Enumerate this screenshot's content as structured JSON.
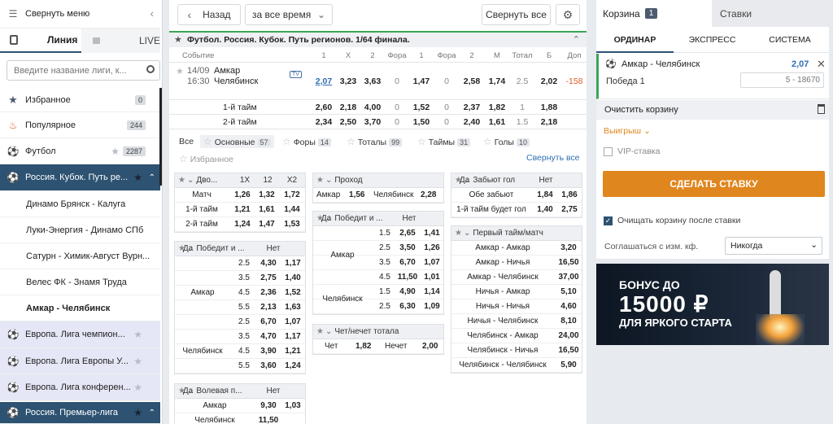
{
  "left": {
    "collapse": "Свернуть меню",
    "tab_line": "Линия",
    "tab_live": "LIVE",
    "search_placeholder": "Введите название лиги, к...",
    "items": [
      {
        "label": "Избранное",
        "badge": "0"
      },
      {
        "label": "Популярное",
        "badge": "244"
      },
      {
        "label": "Футбол",
        "badge": "2287"
      },
      {
        "label": "Россия. Кубок. Путь ре..."
      },
      {
        "label": "Динамо Брянск - Калуга"
      },
      {
        "label": "Луки-Энергия - Динамо СПб"
      },
      {
        "label": "Сатурн - Химик-Август Вурн..."
      },
      {
        "label": "Велес ФК - Знамя Труда"
      },
      {
        "label": "Амкар - Челябинск"
      },
      {
        "label": "Европа. Лига чемпион..."
      },
      {
        "label": "Европа. Лига Европы У..."
      },
      {
        "label": "Европа. Лига конферен..."
      },
      {
        "label": "Россия. Премьер-лига"
      }
    ]
  },
  "top": {
    "back": "Назад",
    "period": "за все время",
    "collapse_all": "Свернуть все"
  },
  "league": "Футбол. Россия. Кубок. Путь регионов. 1/64 финала.",
  "headers": [
    "Событие",
    "1",
    "X",
    "2",
    "Фора",
    "1",
    "Фора",
    "2",
    "М",
    "Тотал",
    "Б",
    "Доп"
  ],
  "event": {
    "date": "14/09",
    "time": "16:30",
    "team1": "Амкар",
    "team2": "Челябинск",
    "tv": "TV",
    "odds": [
      "2,07",
      "3,23",
      "3,63",
      "0",
      "1,47",
      "0",
      "2,58",
      "1,74",
      "2.5",
      "2,02",
      "-158"
    ]
  },
  "halves": [
    {
      "label": "1-й тайм",
      "odds": [
        "2,60",
        "2,18",
        "4,00",
        "0",
        "1,52",
        "0",
        "2,37",
        "1,82",
        "1",
        "1,88"
      ]
    },
    {
      "label": "2-й тайм",
      "odds": [
        "2,34",
        "2,50",
        "3,70",
        "0",
        "1,50",
        "0",
        "2,40",
        "1,61",
        "1.5",
        "2,18"
      ]
    }
  ],
  "tabs": [
    {
      "label": "Все"
    },
    {
      "label": "Основные",
      "count": "57"
    },
    {
      "label": "Форы",
      "count": "14"
    },
    {
      "label": "Тоталы",
      "count": "99"
    },
    {
      "label": "Таймы",
      "count": "31"
    },
    {
      "label": "Голы",
      "count": "10"
    }
  ],
  "fav": "Избранное",
  "collapse_all2": "Свернуть все",
  "m1": {
    "h": [
      "Дво...",
      "1X",
      "12",
      "X2"
    ],
    "rows": [
      [
        "Матч",
        "1,26",
        "1,32",
        "1,72"
      ],
      [
        "1-й тайм",
        "1,21",
        "1,61",
        "1,44"
      ],
      [
        "2-й тайм",
        "1,24",
        "1,47",
        "1,53"
      ]
    ]
  },
  "m2": {
    "h": [
      "Победит и ...",
      "Да",
      "Нет"
    ],
    "t1": "Амкар",
    "t2": "Челябинск",
    "rows": [
      [
        "2.5",
        "4,30",
        "1,17"
      ],
      [
        "3.5",
        "2,75",
        "1,40"
      ],
      [
        "4.5",
        "2,36",
        "1,52"
      ],
      [
        "5.5",
        "2,13",
        "1,63"
      ],
      [
        "2.5",
        "6,70",
        "1,07"
      ],
      [
        "3.5",
        "4,70",
        "1,17"
      ],
      [
        "4.5",
        "3,90",
        "1,21"
      ],
      [
        "5.5",
        "3,60",
        "1,24"
      ]
    ]
  },
  "m3": {
    "h": [
      "Волевая п...",
      "Да",
      "Нет"
    ],
    "rows": [
      [
        "Амкар",
        "9,30",
        "1,03"
      ],
      [
        "Челябинск",
        "11,50",
        ""
      ]
    ]
  },
  "m4": {
    "h": "Проход",
    "row": [
      "Амкар",
      "1,56",
      "Челябинск",
      "2,28"
    ]
  },
  "m5": {
    "h": [
      "Победит и ...",
      "Да",
      "Нет"
    ],
    "t1": "Амкар",
    "t2": "Челябинск",
    "rows": [
      [
        "1.5",
        "2,65",
        "1,41"
      ],
      [
        "2.5",
        "3,50",
        "1,26"
      ],
      [
        "3.5",
        "6,70",
        "1,07"
      ],
      [
        "4.5",
        "11,50",
        "1,01"
      ],
      [
        "1.5",
        "4,90",
        "1,14"
      ],
      [
        "2.5",
        "6,30",
        "1,09"
      ]
    ]
  },
  "m6": {
    "h": "Чет/нечет тотала",
    "row": [
      "Чет",
      "1,82",
      "Нечет",
      "2,00"
    ]
  },
  "m7": {
    "h": [
      "Забьют гол",
      "Да",
      "Нет"
    ],
    "rows": [
      [
        "Обе забьют",
        "1,84",
        "1,86"
      ],
      [
        "1-й тайм будет гол",
        "1,40",
        "2,75"
      ]
    ]
  },
  "m8": {
    "h": "Первый тайм/матч",
    "rows": [
      [
        "Амкар - Амкар",
        "3,20"
      ],
      [
        "Амкар - Ничья",
        "16,50"
      ],
      [
        "Амкар - Челябинск",
        "37,00"
      ],
      [
        "Ничья - Амкар",
        "5,10"
      ],
      [
        "Ничья - Ничья",
        "4,60"
      ],
      [
        "Ничья - Челябинск",
        "8,10"
      ],
      [
        "Челябинск - Амкар",
        "24,00"
      ],
      [
        "Челябинск - Ничья",
        "16,50"
      ],
      [
        "Челябинск - Челябинск",
        "5,90"
      ]
    ]
  },
  "cart": {
    "title": "Корзина",
    "count": "1",
    "bets": "Ставки",
    "types": [
      "ОРДИНАР",
      "ЭКСПРЕСС",
      "СИСТЕМА"
    ],
    "match": "Амкар - Челябинск",
    "odd": "2,07",
    "outcome": "Победа 1",
    "placeholder": "5 - 18670",
    "clear": "Очистить корзину",
    "win": "Выигрыш",
    "vip": "VIP-ставка",
    "make": "СДЕЛАТЬ СТАВКУ",
    "clear_after": "Очищать корзину после ставки",
    "agree": "Соглашаться с изм. кф.",
    "never": "Никогда"
  },
  "banner": {
    "l1": "БОНУС ДО",
    "l2": "15000 ₽",
    "l3": "ДЛЯ ЯРКОГО СТАРТА"
  }
}
